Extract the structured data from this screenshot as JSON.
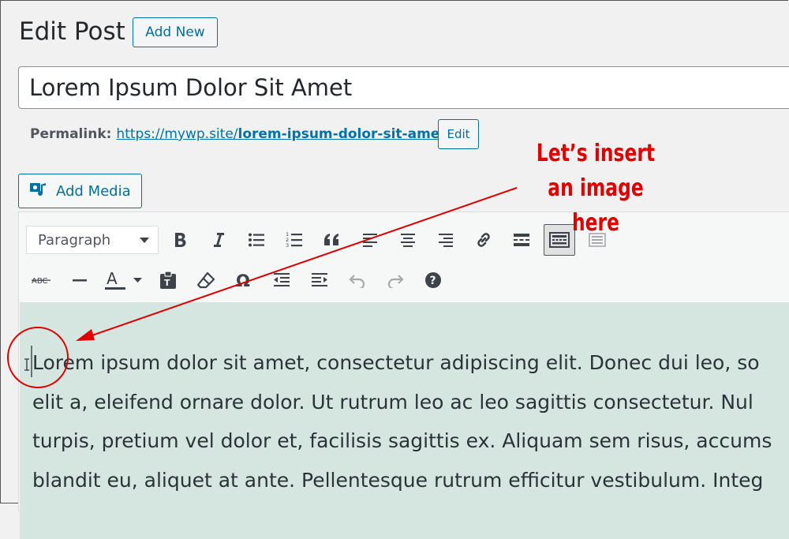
{
  "header": {
    "title": "Edit Post",
    "add_new_label": "Add New"
  },
  "post": {
    "title": "Lorem Ipsum Dolor Sit Amet"
  },
  "permalink": {
    "label": "Permalink:",
    "base": "https://mywp.site/",
    "slug": "lorem-ipsum-dolor-sit-amet",
    "tail": "/",
    "edit_label": "Edit"
  },
  "media": {
    "add_media_label": "Add Media"
  },
  "toolbar": {
    "format_value": "Paragraph",
    "row1_icons": [
      "bold-icon",
      "italic-icon",
      "bulleted-list-icon",
      "numbered-list-icon",
      "blockquote-icon",
      "align-left-icon",
      "align-center-icon",
      "align-right-icon",
      "insert-link-icon",
      "read-more-icon",
      "toolbar-toggle-icon",
      "distraction-free-icon"
    ],
    "row2_icons": [
      "strikethrough-icon",
      "horizontal-line-icon",
      "text-color-icon",
      "paste-as-text-icon",
      "clear-formatting-icon",
      "special-character-icon",
      "outdent-icon",
      "indent-icon",
      "undo-icon",
      "redo-icon",
      "keyboard-shortcuts-icon"
    ]
  },
  "content": {
    "lines": [
      "Lorem ipsum dolor sit amet, consectetur adipiscing elit. Donec dui leo, so",
      "elit a, eleifend ornare dolor. Ut rutrum leo ac leo sagittis consectetur. Nul",
      "turpis, pretium vel dolor et, facilisis sagittis ex. Aliquam sem risus, accums",
      "blandit eu, aliquet at ante. Pellentesque rutrum efficitur vestibulum. Integ"
    ]
  },
  "annotation": {
    "line1": "Let’s insert",
    "line2": "an image here",
    "color": "#e00000"
  },
  "colors": {
    "accent": "#0071a1",
    "editor_bg": "#d4e6df",
    "page_bg": "#f1f1f1"
  }
}
